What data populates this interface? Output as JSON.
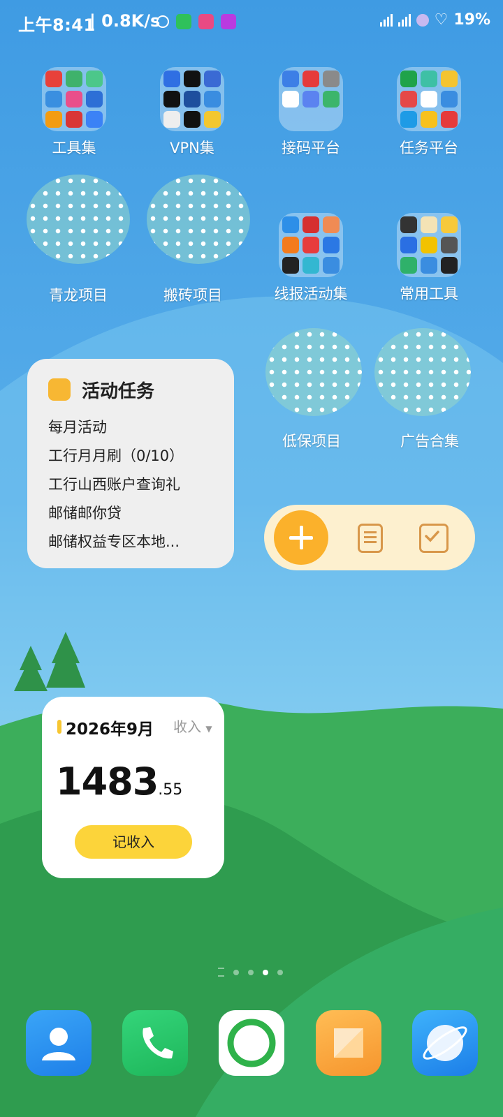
{
  "status_bar": {
    "time": "上午8:41",
    "network_speed": "| 0.8K/s",
    "battery": "19%",
    "icons": [
      "alarm-icon",
      "wechat-icon",
      "app-notification-icon",
      "bell-app-icon",
      "signal-icon",
      "signal-icon",
      "saturn-icon",
      "heart-icon"
    ]
  },
  "folders": [
    {
      "label": "工具集",
      "tiles": [
        "#e8413a",
        "#3fb26b",
        "#4cc78a",
        "#3a8fe0",
        "#e94f8a",
        "#2d6fd6",
        "#f39c12",
        "#d93636",
        "#3b82f6"
      ]
    },
    {
      "label": "VPN集",
      "tiles": [
        "#2f6fe3",
        "#111111",
        "#3a6ad4",
        "#111111",
        "#1e4f9e",
        "#3a8de0",
        "#eeeeee",
        "#111111",
        "#f3c72f"
      ]
    },
    {
      "label": "接码平台",
      "tiles": [
        "#3d7fe6",
        "#e53b3b",
        "#8a8a8a",
        "#ffffff",
        "#5b83f0",
        "#3cb56b"
      ]
    },
    {
      "label": "任务平台",
      "tiles": [
        "#1fa34a",
        "#3ec0a5",
        "#f4c430",
        "#e54848",
        "#ffffff",
        "#3a8de0",
        "#1e9be6",
        "#f7c11d",
        "#e53b3b"
      ]
    },
    {
      "label": "线报活动集",
      "tiles": [
        "#2d8fe8",
        "#d62f2f",
        "#f08b54",
        "#f37b1d",
        "#e73c3c",
        "#2b78e4",
        "#222222",
        "#33b7d1",
        "#3a8de0"
      ]
    },
    {
      "label": "常用工具",
      "tiles": [
        "#333333",
        "#f4e3b5",
        "#f7c93b",
        "#2a6fe3",
        "#f2c200",
        "#555555",
        "#2fb16a",
        "#3a8de0",
        "#222222"
      ]
    }
  ],
  "dotted_folders": [
    {
      "label": "青龙项目"
    },
    {
      "label": "搬砖项目"
    },
    {
      "label": "低保项目"
    },
    {
      "label": "广告合集"
    }
  ],
  "task_widget": {
    "title": "活动任务",
    "items": [
      "每月活动",
      "工行月月刷（0/10）",
      "工行山西账户查询礼",
      "邮储邮你贷",
      "邮储权益专区本地..."
    ]
  },
  "quick_actions": {
    "add": "add-icon",
    "note": "note-icon",
    "check": "checkbox-icon"
  },
  "income_widget": {
    "month": "2026年9月",
    "type": "收入",
    "amount_int": "1483",
    "amount_dec": ".55",
    "button": "记收入"
  },
  "page_indicator": {
    "pages": 4,
    "current": 3
  },
  "dock": [
    {
      "name": "contacts",
      "icon": "contacts-icon",
      "color": "#2b8ff0"
    },
    {
      "name": "phone",
      "icon": "phone-icon",
      "color": "#25c267"
    },
    {
      "name": "camera",
      "icon": "ring-app-icon",
      "color": "#ffffff"
    },
    {
      "name": "notes",
      "icon": "notes-icon",
      "color": "#f7a53a"
    },
    {
      "name": "browser",
      "icon": "browser-icon",
      "color": "#2894f0"
    }
  ]
}
